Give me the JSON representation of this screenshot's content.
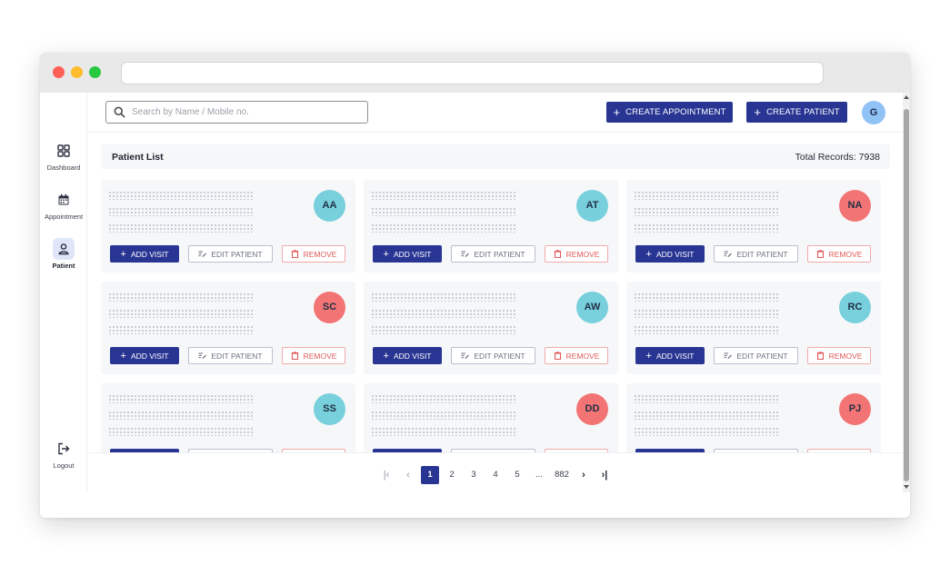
{
  "sidebar": {
    "items": [
      {
        "label": "Dashboard",
        "icon": "grid-icon"
      },
      {
        "label": "Appointment",
        "icon": "calendar-icon"
      },
      {
        "label": "Patient",
        "icon": "person-icon",
        "active": true
      }
    ],
    "logout": {
      "label": "Logout",
      "icon": "logout-icon"
    }
  },
  "header": {
    "search": {
      "placeholder": "Search by Name / Mobile no.",
      "value": ""
    },
    "create_appointment_label": "CREATE APPOINTMENT",
    "create_patient_label": "CREATE PATIENT",
    "user_avatar": "G"
  },
  "patient_list": {
    "title": "Patient List",
    "total_records": "Total Records: 7938",
    "actions": {
      "add_visit": "ADD VISIT",
      "edit_patient": "EDIT PATIENT",
      "remove": "REMOVE"
    },
    "patients": [
      {
        "initials": "AA",
        "color": "#77d0dc"
      },
      {
        "initials": "AT",
        "color": "#77d0dc"
      },
      {
        "initials": "NA",
        "color": "#f37474"
      },
      {
        "initials": "SC",
        "color": "#f37474"
      },
      {
        "initials": "AW",
        "color": "#77d0dc"
      },
      {
        "initials": "RC",
        "color": "#77d0dc"
      },
      {
        "initials": "SS",
        "color": "#77d0dc"
      },
      {
        "initials": "DD",
        "color": "#f37474"
      },
      {
        "initials": "PJ",
        "color": "#f37474"
      }
    ]
  },
  "pagination": {
    "pages": [
      "1",
      "2",
      "3",
      "4",
      "5",
      "...",
      "882"
    ],
    "current": "1"
  },
  "colors": {
    "primary": "#283593",
    "danger": "#e05b5b",
    "avatar_teal": "#77d0dc",
    "avatar_red": "#f37474"
  }
}
